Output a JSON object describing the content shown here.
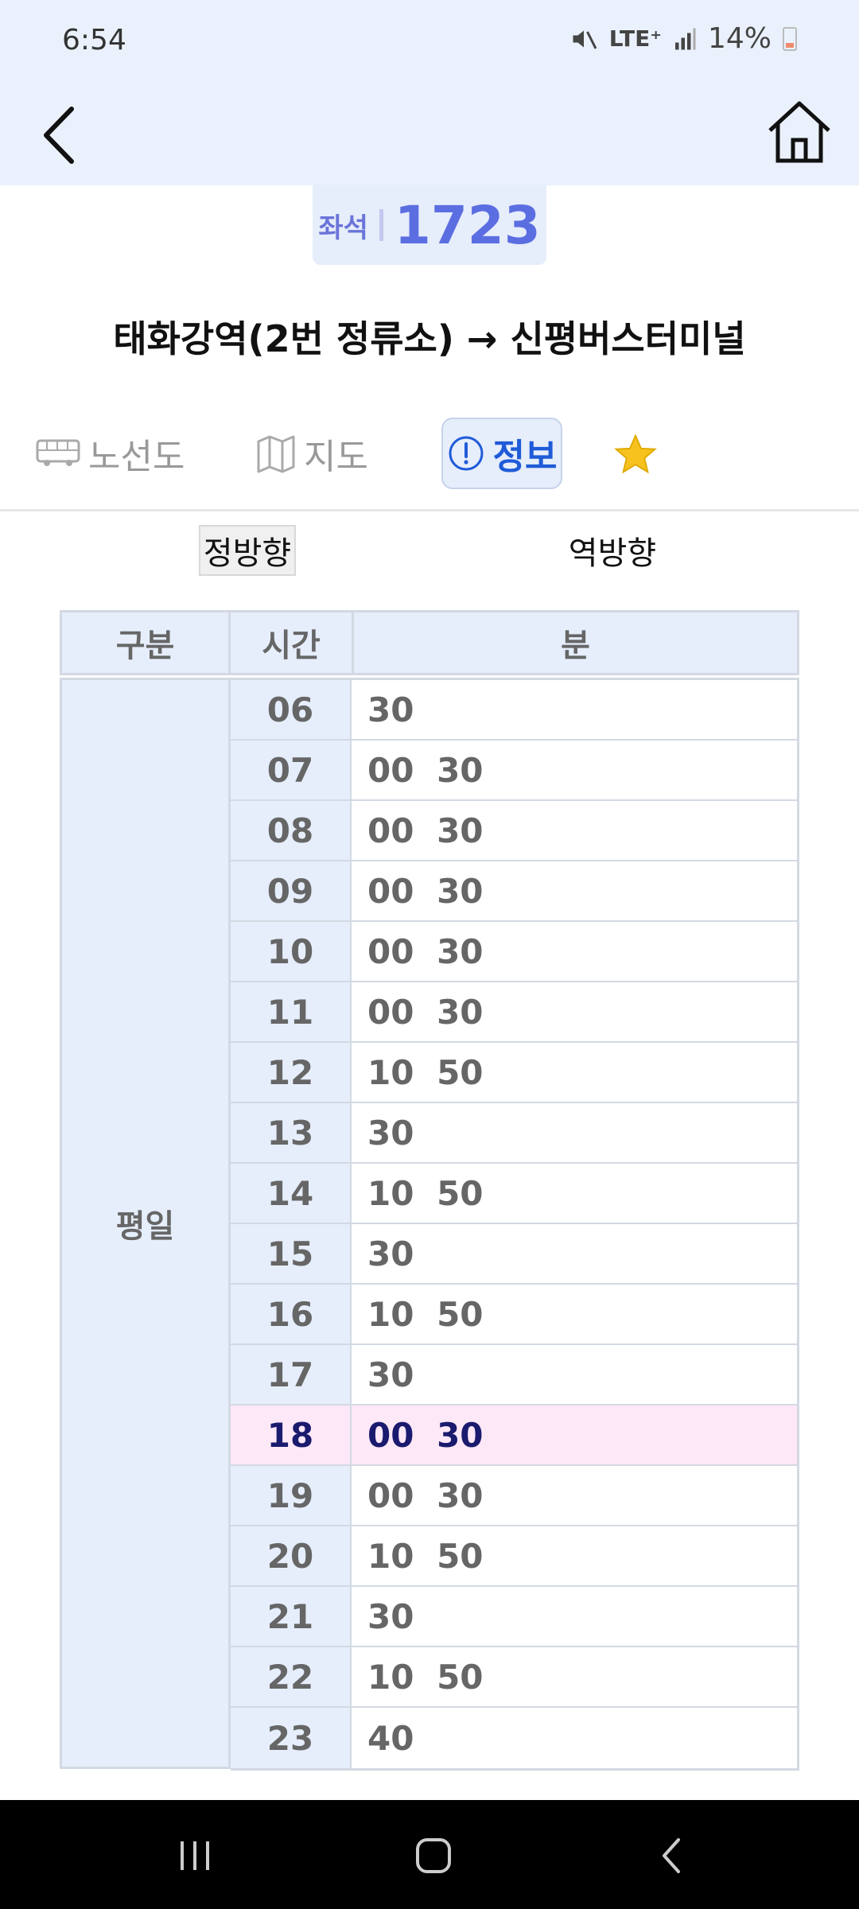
{
  "status": {
    "time": "6:54",
    "network": "LTE⁺",
    "battery": "14%"
  },
  "route": {
    "seat_label": "좌석",
    "number": "1723",
    "title": "태화강역(2번 정류소) → 신평버스터미널"
  },
  "tabs": [
    {
      "label": "노선도",
      "icon": "bus-icon"
    },
    {
      "label": "지도",
      "icon": "map-icon"
    },
    {
      "label": "정보",
      "icon": "info-icon",
      "active": true
    }
  ],
  "directions": {
    "forward": "정방향",
    "reverse": "역방향"
  },
  "timetable": {
    "headers": {
      "category": "구분",
      "hour": "시간",
      "minute": "분"
    },
    "day_type": "평일",
    "highlight_hour": "18",
    "rows": [
      {
        "hour": "06",
        "minutes": "30"
      },
      {
        "hour": "07",
        "minutes": "00 30"
      },
      {
        "hour": "08",
        "minutes": "00 30"
      },
      {
        "hour": "09",
        "minutes": "00 30"
      },
      {
        "hour": "10",
        "minutes": "00 30"
      },
      {
        "hour": "11",
        "minutes": "00 30"
      },
      {
        "hour": "12",
        "minutes": "10 50"
      },
      {
        "hour": "13",
        "minutes": "30"
      },
      {
        "hour": "14",
        "minutes": "10 50"
      },
      {
        "hour": "15",
        "minutes": "30"
      },
      {
        "hour": "16",
        "minutes": "10 50"
      },
      {
        "hour": "17",
        "minutes": "30"
      },
      {
        "hour": "18",
        "minutes": "00 30"
      },
      {
        "hour": "19",
        "minutes": "00 30"
      },
      {
        "hour": "20",
        "minutes": "10 50"
      },
      {
        "hour": "21",
        "minutes": "30"
      },
      {
        "hour": "22",
        "minutes": "10 50"
      },
      {
        "hour": "23",
        "minutes": "40"
      }
    ]
  },
  "colors": {
    "header_bg": "#eaf1fc",
    "accent": "#1f5bd8",
    "route_number": "#5b6ee1",
    "highlight_row": "#fde8f7",
    "star": "#f7c21e"
  }
}
